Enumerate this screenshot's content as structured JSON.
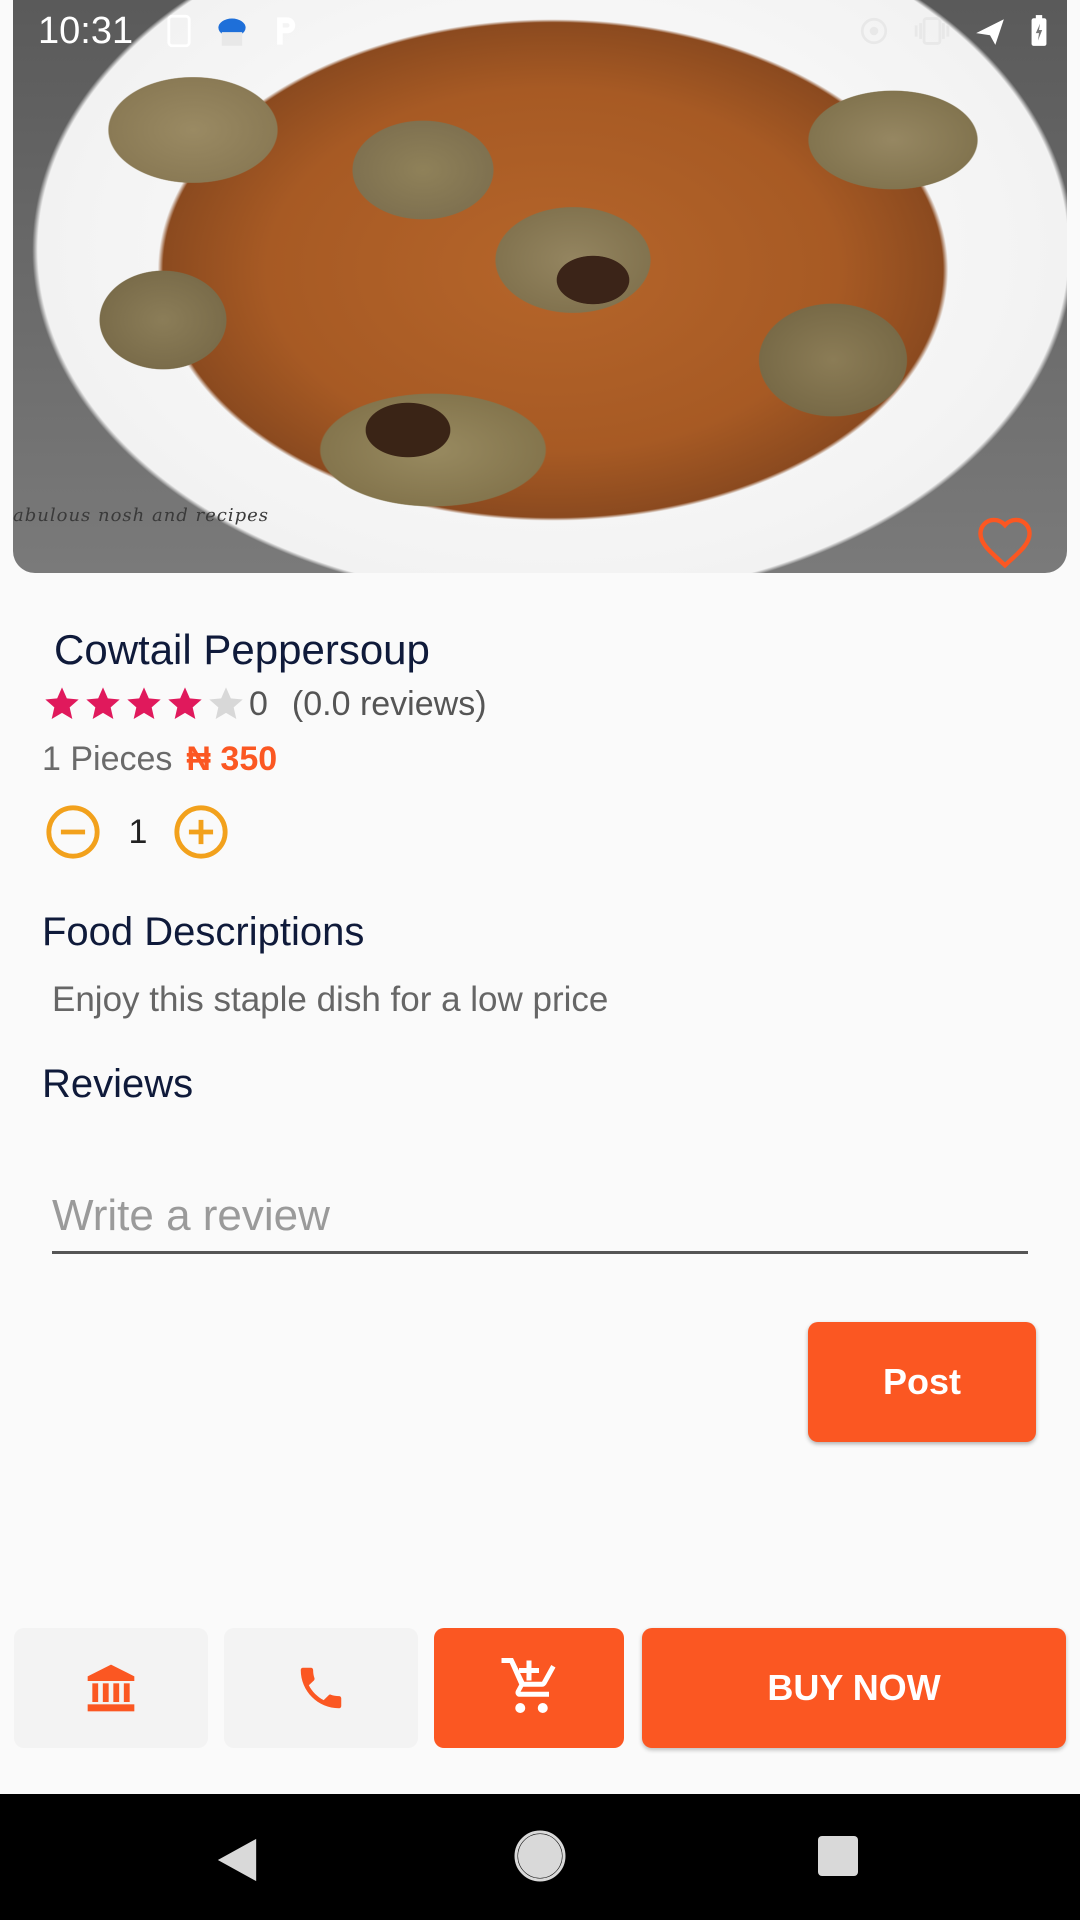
{
  "status_bar": {
    "time": "10:31",
    "left_icons": [
      "sim-card-icon",
      "cloud-test-icon",
      "parking-icon"
    ],
    "right_icons": [
      "hotspot-icon",
      "vibrate-icon",
      "airplane-icon",
      "battery-icon"
    ]
  },
  "hero": {
    "watermark": "abulous nosh and recipes",
    "favorite_icon": "heart-outline-icon"
  },
  "product": {
    "title": "Cowtail Peppersoup",
    "rating": {
      "stars_filled": 4,
      "stars_total": 5,
      "value": "0",
      "reviews": "(0.0 reviews)"
    },
    "pieces": "1 Pieces",
    "price": "₦ 350",
    "quantity": "1"
  },
  "description": {
    "title": "Food Descriptions",
    "text": "Enjoy this staple dish for a low price"
  },
  "reviews": {
    "title": "Reviews",
    "placeholder": "Write a review",
    "post_label": "Post"
  },
  "actions": {
    "bank_icon": "bank-icon",
    "call_icon": "phone-icon",
    "cart_icon": "add-to-cart-icon",
    "buy_label": "BUY NOW"
  },
  "colors": {
    "accent": "#fb5722",
    "star": "#e0195c",
    "qty_icon": "#f2a11c",
    "title": "#0f1a3a"
  }
}
